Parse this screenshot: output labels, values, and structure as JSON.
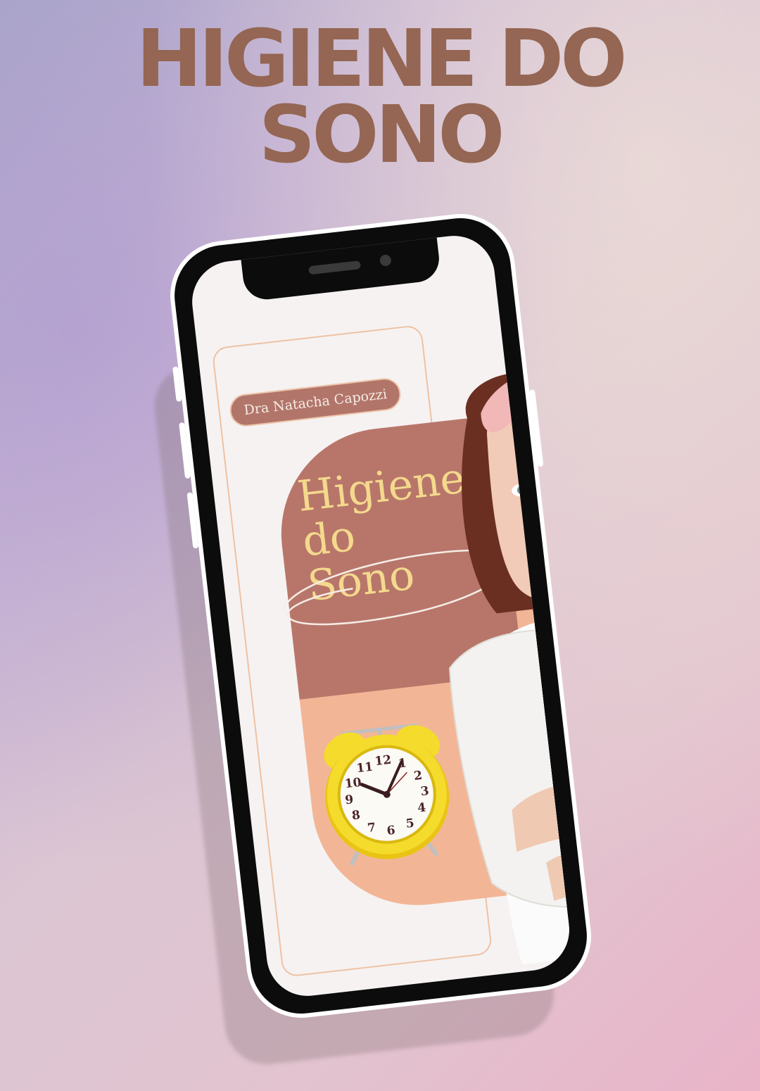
{
  "poster": {
    "headline_line1": "HIGIENE DO",
    "headline_line2": "SONO"
  },
  "phone_screen": {
    "author": "Dra Natacha Capozzi",
    "cover_title_line1": "Higiene",
    "cover_title_line2": "do",
    "cover_title_line3": "Sono"
  },
  "clock": {
    "numbers": [
      "12",
      "1",
      "2",
      "3",
      "4",
      "5",
      "6",
      "7",
      "8",
      "9",
      "10",
      "11"
    ]
  },
  "colors": {
    "headline": "#946653",
    "title_block": "#b8766a",
    "peach_block": "#f2b696",
    "cover_title": "#f4d98d",
    "clock_body": "#f4db2c"
  }
}
